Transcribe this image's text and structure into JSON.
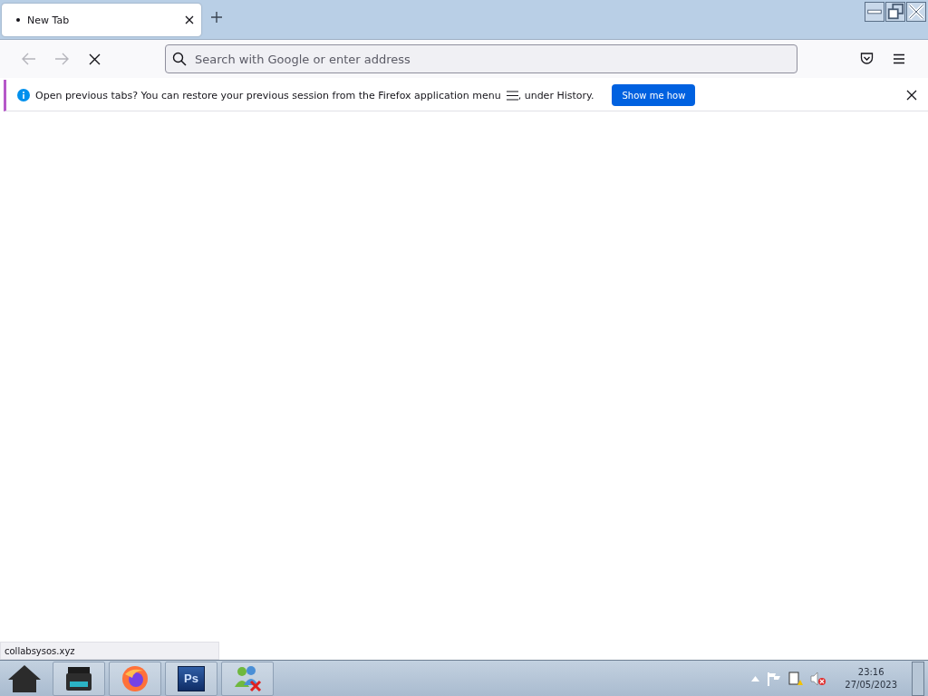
{
  "tabs": [
    {
      "label": "New Tab",
      "selected": true
    }
  ],
  "address_bar": {
    "placeholder": "Search with Google or enter address"
  },
  "notification": {
    "message": "Open previous tabs? You can restore your previous session from the Firefox application menu",
    "message_end": ", under History.",
    "button": "Show me how"
  },
  "status_link": "collabsysos.xyz",
  "taskbar": {
    "apps": [
      {
        "kind": "home"
      },
      {
        "kind": "scanner"
      },
      {
        "kind": "firefox"
      },
      {
        "kind": "photoshop",
        "label": "Ps"
      },
      {
        "kind": "people"
      }
    ],
    "clock": {
      "time": "23:16",
      "date": "27/05/2023"
    }
  }
}
